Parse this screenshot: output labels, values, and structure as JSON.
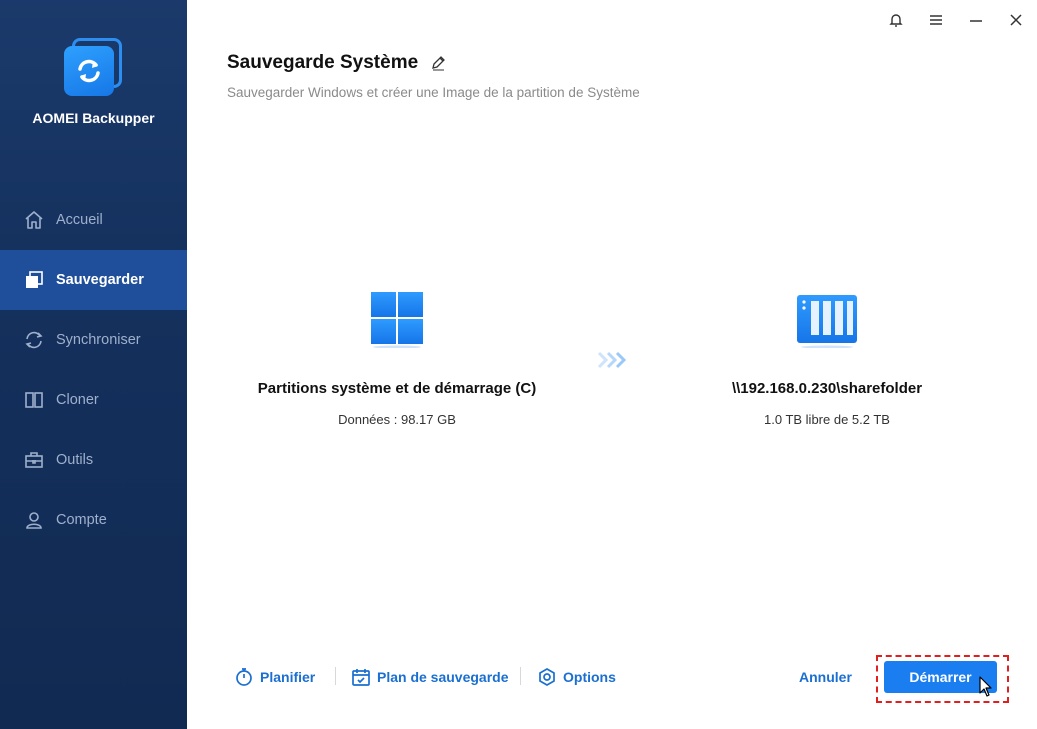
{
  "app": {
    "name": "AOMEI Backupper"
  },
  "sidebar": {
    "items": [
      {
        "label": "Accueil",
        "icon": "home-icon"
      },
      {
        "label": "Sauvegarder",
        "icon": "backup-icon",
        "active": true
      },
      {
        "label": "Synchroniser",
        "icon": "sync-icon"
      },
      {
        "label": "Cloner",
        "icon": "clone-icon"
      },
      {
        "label": "Outils",
        "icon": "toolbox-icon"
      },
      {
        "label": "Compte",
        "icon": "user-icon"
      }
    ]
  },
  "window": {
    "controls": [
      "bell-icon",
      "menu-icon",
      "minimize-icon",
      "close-icon"
    ]
  },
  "main": {
    "title": "Sauvegarde Système",
    "subtitle": "Sauvegarder Windows et créer une Image de la partition de Système",
    "source": {
      "name": "Partitions système et de démarrage (C)",
      "detail": "Données : 98.17 GB",
      "icon": "windows-icon"
    },
    "destination": {
      "name": "\\\\192.168.0.230\\sharefolder",
      "detail": "1.0 TB libre de 5.2 TB",
      "icon": "nas-icon"
    }
  },
  "bottom": {
    "schedule_label": "Planifier",
    "plan_label": "Plan de sauvegarde",
    "options_label": "Options",
    "cancel_label": "Annuler",
    "start_label": "Démarrer"
  },
  "colors": {
    "sidebar_bg": "#14305c",
    "active_item": "#1f4f9a",
    "accent": "#1a7ef0",
    "link": "#1a6fd1",
    "highlight": "#e0201e"
  }
}
